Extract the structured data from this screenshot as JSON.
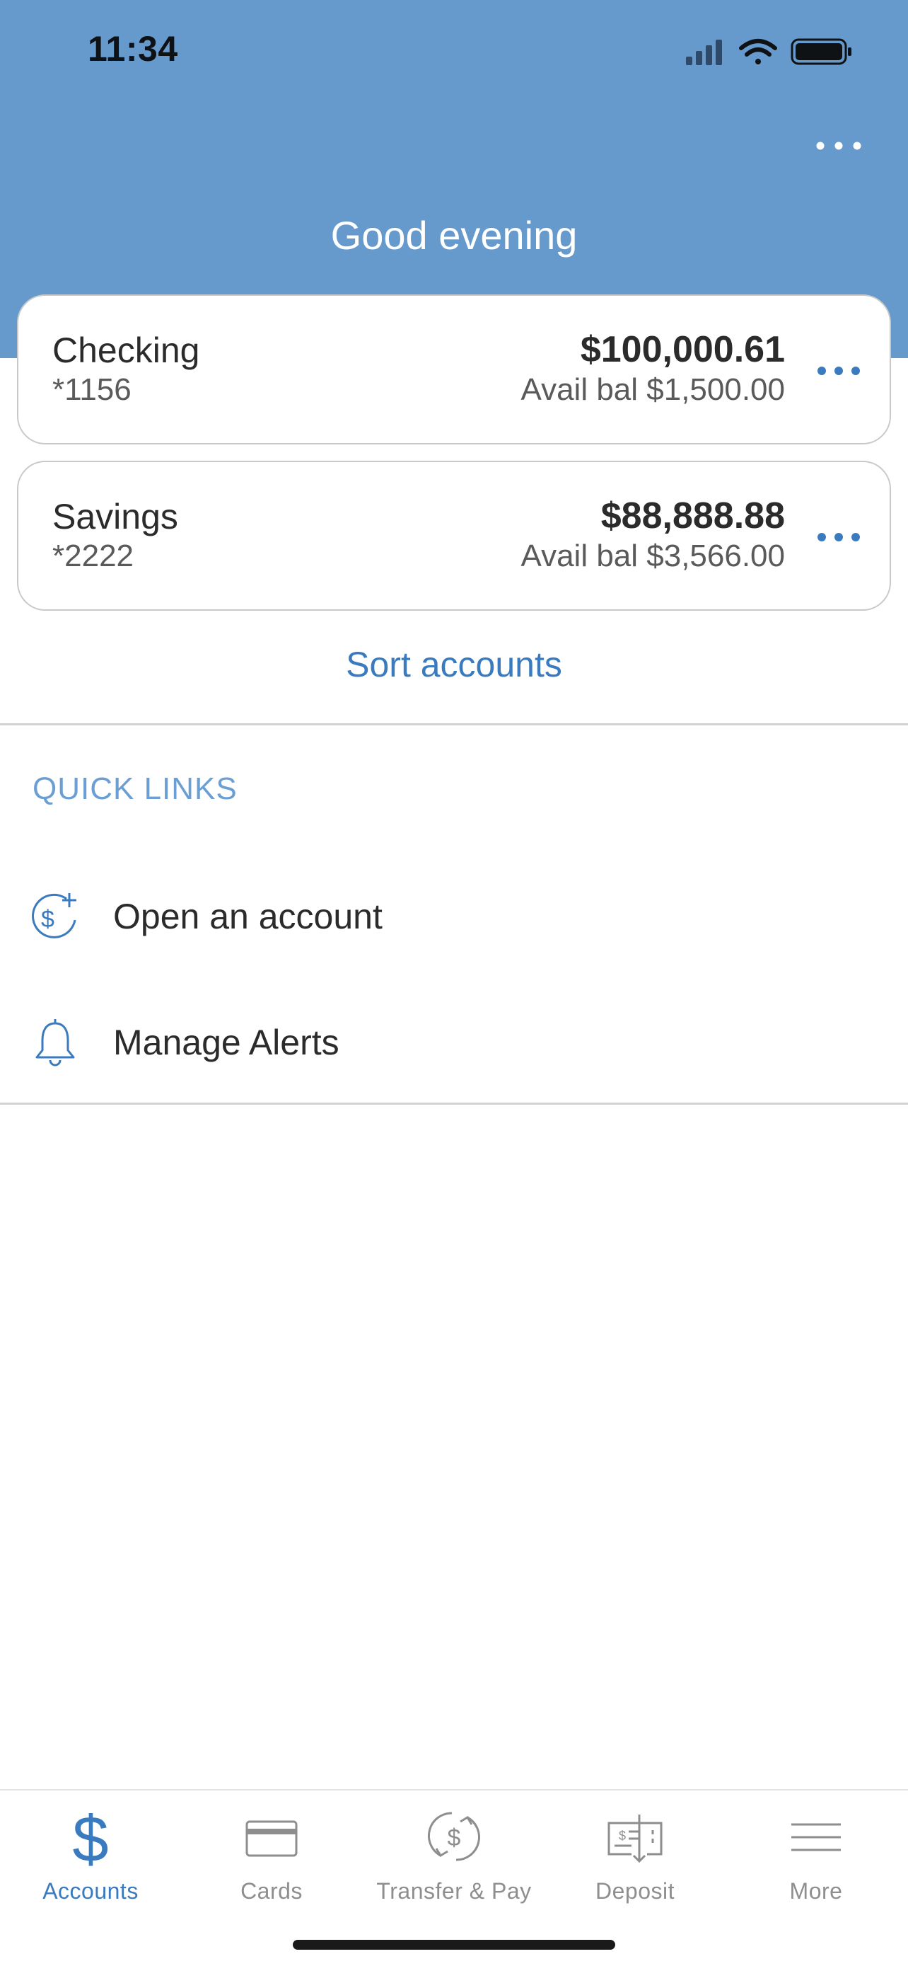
{
  "status_bar": {
    "time": "11:34",
    "icons": [
      "cellular-signal-icon",
      "wifi-icon",
      "battery-icon"
    ]
  },
  "header": {
    "greeting": "Good evening",
    "more_icon": "more-horizontal-icon",
    "background_color": "#6699cc"
  },
  "accounts": [
    {
      "name": "Checking",
      "number": "*1156",
      "balance": "$100,000.61",
      "available": "Avail bal $1,500.00"
    },
    {
      "name": "Savings",
      "number": "*2222",
      "balance": "$88,888.88",
      "available": "Avail bal $3,566.00"
    }
  ],
  "sort_accounts_label": "Sort accounts",
  "quick_links": {
    "title": "QUICK LINKS",
    "items": [
      {
        "label": "Open an account",
        "icon": "dollar-plus-icon"
      },
      {
        "label": "Manage Alerts",
        "icon": "bell-icon"
      }
    ]
  },
  "tab_bar": {
    "active_color": "#3a7bbf",
    "inactive_color": "#8e8e8e",
    "tabs": [
      {
        "label": "Accounts",
        "icon": "dollar-icon",
        "active": true
      },
      {
        "label": "Cards",
        "icon": "card-icon",
        "active": false
      },
      {
        "label": "Transfer & Pay",
        "icon": "transfer-icon",
        "active": false
      },
      {
        "label": "Deposit",
        "icon": "check-deposit-icon",
        "active": false
      },
      {
        "label": "More",
        "icon": "menu-icon",
        "active": false
      }
    ]
  }
}
